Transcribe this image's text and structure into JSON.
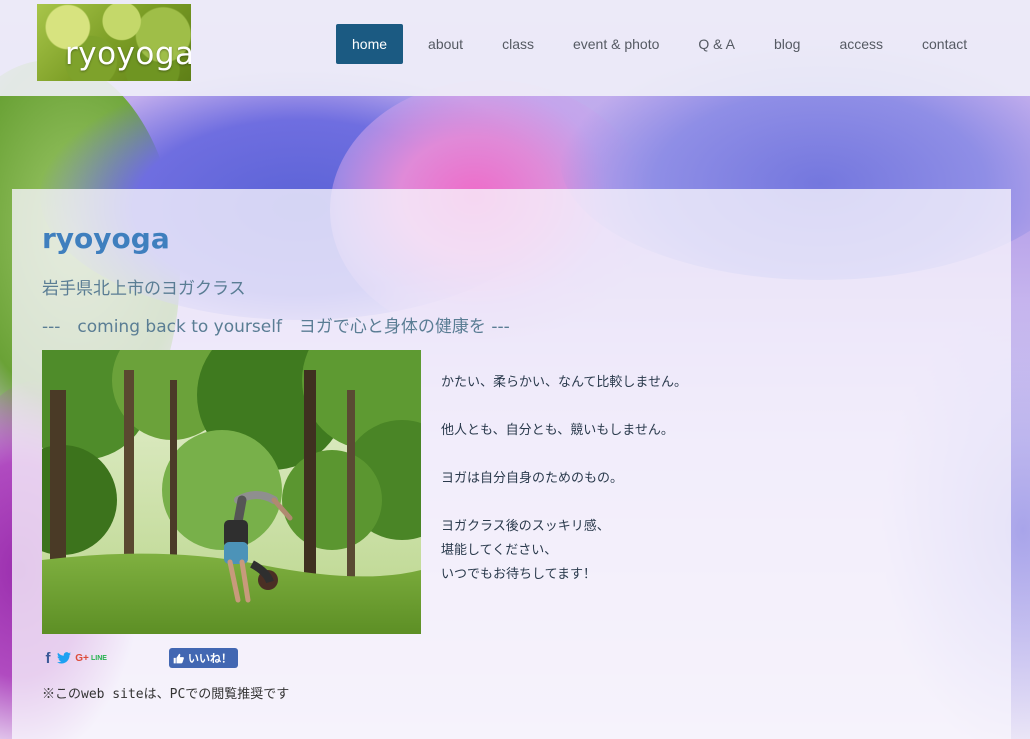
{
  "brand": {
    "logo_text": "ryoyoga"
  },
  "nav": {
    "items": [
      {
        "label": "home"
      },
      {
        "label": "about"
      },
      {
        "label": "class"
      },
      {
        "label": "event & photo"
      },
      {
        "label": "Q & A"
      },
      {
        "label": "blog"
      },
      {
        "label": "access"
      },
      {
        "label": "contact"
      }
    ],
    "active_index": 0
  },
  "main": {
    "title": "ryoyoga",
    "subtitle": "岩手県北上市のヨガクラス",
    "tagline": "---　coming back to yourself　ヨガで心と身体の健康を ---",
    "photo_icon": "photo-yoga-forest",
    "message": {
      "line1": "かたい、柔らかい、なんて比較しません。",
      "line2": "他人とも、自分とも、競いもしません。",
      "line3": "ヨガは自分自身のためのもの。",
      "line4": "ヨガクラス後のスッキリ感、",
      "line5": "堪能してください、",
      "line6": "いつでもお待ちしてます！"
    }
  },
  "share": {
    "facebook_glyph": "f",
    "googleplus_glyph": "G+",
    "line_glyph": "LINE",
    "like_label": "いいね！"
  },
  "footer": {
    "note": "※このweb siteは、PCでの閲覧推奨です"
  },
  "colors": {
    "nav_active_bg": "#1b5a82",
    "title": "#3f7fbe",
    "subtitle": "#5a7d94",
    "like_button": "#4267b2"
  }
}
